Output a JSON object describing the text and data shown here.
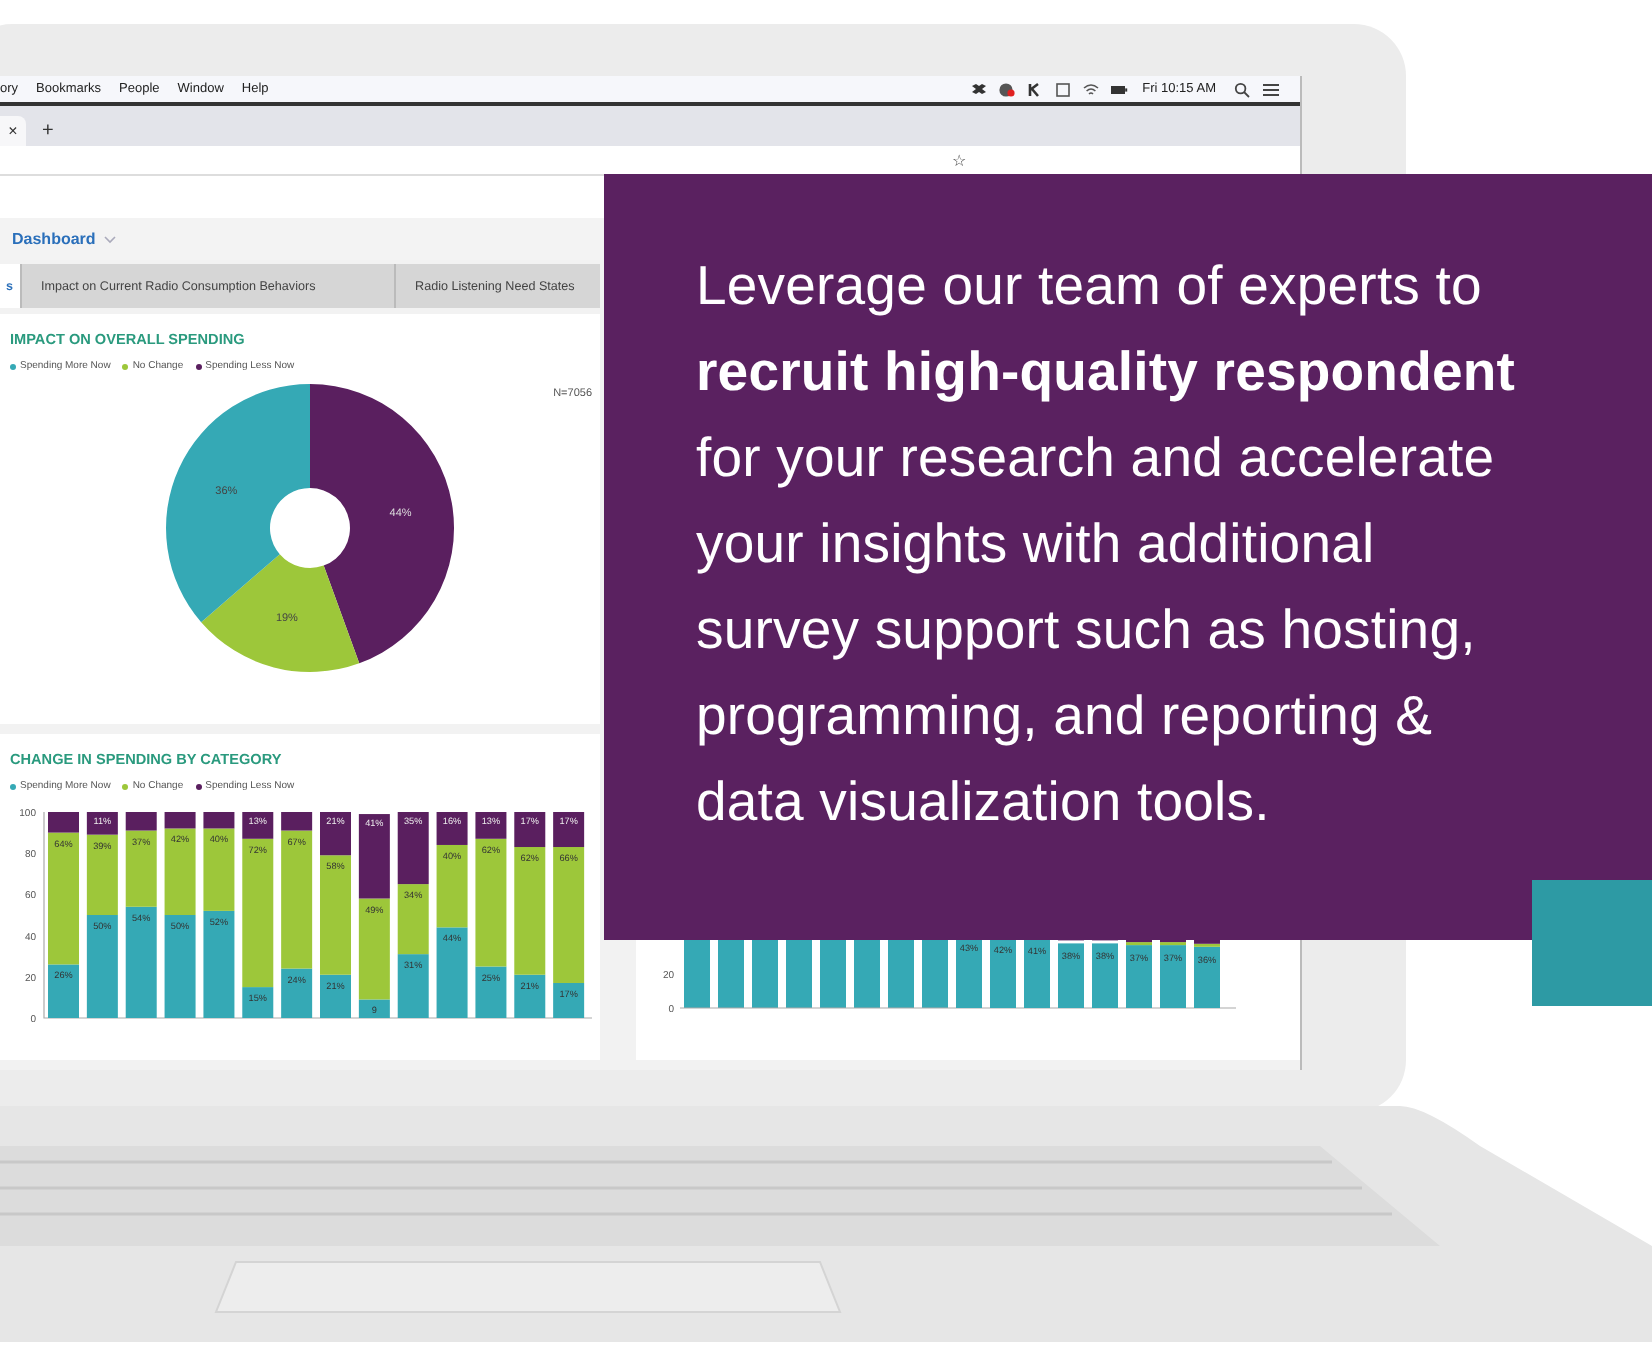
{
  "menu_bar": {
    "menus": [
      "ory",
      "Bookmarks",
      "People",
      "Window",
      "Help"
    ],
    "clock": "Fri 10:15 AM"
  },
  "browser": {
    "tab_close": "×",
    "new_tab": "+",
    "bookmark_star": "☆"
  },
  "dashboard": {
    "breadcrumb": "Dashboard",
    "tabs": [
      {
        "label": "s",
        "selected": true
      },
      {
        "label": "Impact on Current Radio Consumption Behaviors",
        "selected": false
      },
      {
        "label": "Radio Listening Need States",
        "selected": false
      }
    ],
    "pie_panel": {
      "title": "IMPACT ON OVERALL SPENDING",
      "sample_size": "N=7056",
      "chart_data": {
        "type": "donut",
        "categories": [
          "Spending More Now",
          "No Change",
          "Spending Less Now"
        ],
        "colors": [
          "#35a9b5",
          "#9dc73a",
          "#5a1f5f"
        ],
        "values": [
          36,
          19,
          44
        ],
        "value_labels": [
          "36%",
          "19%",
          "44%"
        ]
      }
    },
    "bar_panel": {
      "title": "CHANGE IN SPENDING BY CATEGORY",
      "chart_data": {
        "type": "bar",
        "stacked": true,
        "ylim": [
          0,
          100
        ],
        "yticks": [
          0,
          20,
          40,
          60,
          80,
          100
        ],
        "series": [
          {
            "name": "Spending More Now",
            "color": "#35a9b5",
            "values": [
              26,
              50,
              54,
              50,
              52,
              15,
              24,
              21,
              9,
              31,
              44,
              25,
              21,
              17
            ]
          },
          {
            "name": "No Change",
            "color": "#9dc73a",
            "values": [
              64,
              39,
              37,
              42,
              40,
              72,
              67,
              58,
              49,
              34,
              40,
              62,
              62,
              66
            ]
          },
          {
            "name": "Spending Less Now",
            "color": "#5a1f5f",
            "values": [
              10,
              11,
              9,
              8,
              8,
              13,
              9,
              21,
              41,
              35,
              16,
              13,
              17,
              17
            ]
          }
        ],
        "value_labels": [
          [
            "26%",
            "50%",
            "54%",
            "50%",
            "52%",
            "15%",
            "24%",
            "21%",
            "9",
            "31%",
            "44%",
            "25%",
            "21%",
            "17%"
          ],
          [
            "64%",
            "39%",
            "37%",
            "42%",
            "40%",
            "72%",
            "67%",
            "58%",
            "49%",
            "34%",
            "40%",
            "62%",
            "62%",
            "66%"
          ],
          [
            null,
            "11%",
            null,
            null,
            null,
            "13%",
            null,
            "21%",
            "41%",
            "35%",
            "16%",
            "13%",
            "17%",
            "17%"
          ]
        ]
      }
    },
    "right_panel": {
      "chart_data": {
        "type": "bar",
        "ylim": [
          0,
          100
        ],
        "yticks": [
          0,
          20
        ],
        "series": [
          {
            "color": "#35a9b5",
            "values": [
              null,
              null,
              null,
              null,
              null,
              null,
              null,
              null,
              43,
              42,
              41,
              38,
              38,
              37,
              37,
              36
            ]
          }
        ],
        "value_labels": [
          [
            null,
            null,
            null,
            null,
            null,
            null,
            null,
            null,
            "43%",
            "42%",
            "41%",
            "38%",
            "38%",
            "37%",
            "37%",
            "36%"
          ]
        ]
      }
    }
  },
  "promo": {
    "text": "Leverage our team of experts to\n**recruit high-quality respondent**\nfor your research and accelerate\nyour insights with additional\nsurvey support such as hosting,\nprogramming, and reporting &\ndata visualization tools."
  }
}
